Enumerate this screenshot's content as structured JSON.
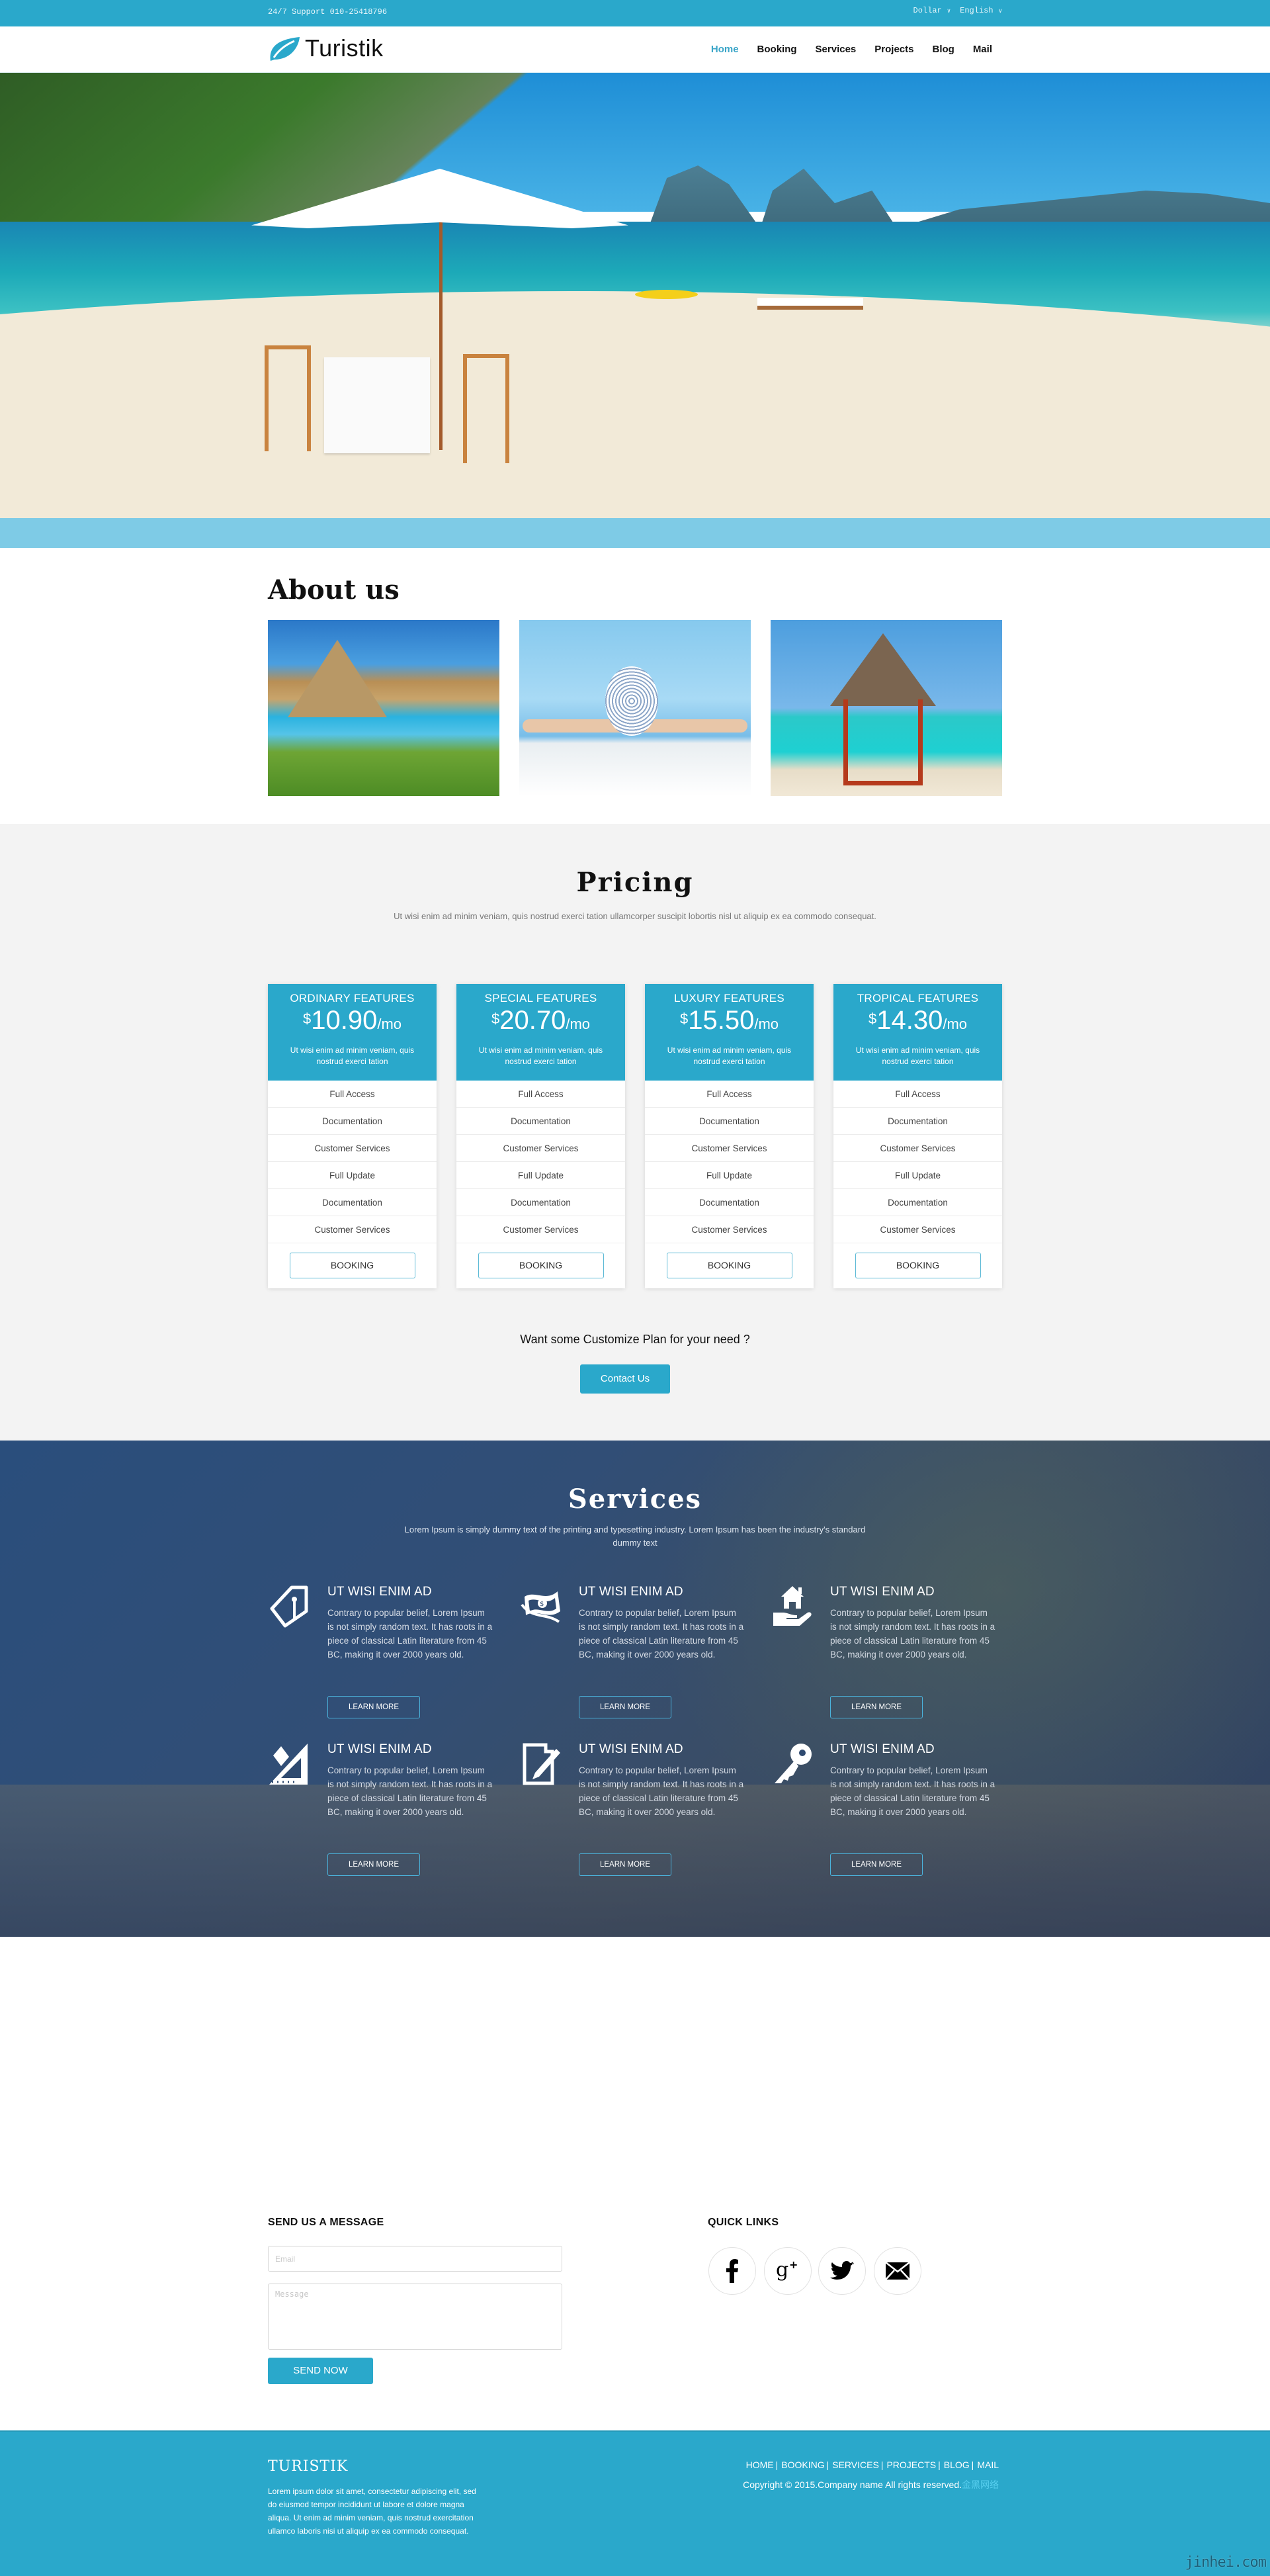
{
  "topbar": {
    "support": "24/7 Support 010-25418796",
    "currency": "Dollar",
    "language": "English"
  },
  "nav": {
    "brand": "Turistik",
    "items": [
      {
        "label": "Home",
        "active": true
      },
      {
        "label": "Booking",
        "active": false
      },
      {
        "label": "Services",
        "active": false
      },
      {
        "label": "Projects",
        "active": false
      },
      {
        "label": "Blog",
        "active": false
      },
      {
        "label": "Mail",
        "active": false
      }
    ]
  },
  "about": {
    "title": "About us",
    "images": [
      "thatched-umbrella-pool",
      "woman-hat-pool",
      "beach-gazebo"
    ]
  },
  "pricing": {
    "title": "Pricing",
    "subtitle": "Ut wisi enim ad minim veniam, quis nostrud exerci tation ullamcorper suscipit lobortis nisl ut aliquip ex ea commodo consequat.",
    "cards": [
      {
        "name": "ORDINARY FEATURES",
        "currency": "$",
        "price": "10.90",
        "period": "/mo",
        "desc": "Ut wisi enim ad minim veniam, quis nostrud exerci tation",
        "features": [
          "Full Access",
          "Documentation",
          "Customer Services",
          "Full Update",
          "Documentation",
          "Customer Services"
        ],
        "button": "BOOKING"
      },
      {
        "name": "SPECIAL FEATURES",
        "currency": "$",
        "price": "20.70",
        "period": "/mo",
        "desc": "Ut wisi enim ad minim veniam, quis nostrud exerci tation",
        "features": [
          "Full Access",
          "Documentation",
          "Customer Services",
          "Full Update",
          "Documentation",
          "Customer Services"
        ],
        "button": "BOOKING"
      },
      {
        "name": "LUXURY FEATURES",
        "currency": "$",
        "price": "15.50",
        "period": "/mo",
        "desc": "Ut wisi enim ad minim veniam, quis nostrud exerci tation",
        "features": [
          "Full Access",
          "Documentation",
          "Customer Services",
          "Full Update",
          "Documentation",
          "Customer Services"
        ],
        "button": "BOOKING"
      },
      {
        "name": "TROPICAL FEATURES",
        "currency": "$",
        "price": "14.30",
        "period": "/mo",
        "desc": "Ut wisi enim ad minim veniam, quis nostrud exerci tation",
        "features": [
          "Full Access",
          "Documentation",
          "Customer Services",
          "Full Update",
          "Documentation",
          "Customer Services"
        ],
        "button": "BOOKING"
      }
    ],
    "custom_question": "Want some Customize Plan for your need ?",
    "contact_button": "Contact Us"
  },
  "services": {
    "title": "Services",
    "subtitle": "Lorem Ipsum is simply dummy text of the printing and typesetting industry. Lorem Ipsum has been the industry's standard dummy text",
    "items": [
      {
        "icon": "price-tag-icon",
        "title": "UT WISI ENIM AD",
        "text": "Contrary to popular belief, Lorem Ipsum is not simply random text. It has roots in a piece of classical Latin literature from 45 BC, making it over 2000 years old.",
        "button": "LEARN MORE"
      },
      {
        "icon": "money-icon",
        "title": "UT WISI ENIM AD",
        "text": "Contrary to popular belief, Lorem Ipsum is not simply random text. It has roots in a piece of classical Latin literature from 45 BC, making it over 2000 years old.",
        "button": "LEARN MORE"
      },
      {
        "icon": "house-in-hand-icon",
        "title": "UT WISI ENIM AD",
        "text": "Contrary to popular belief, Lorem Ipsum is not simply random text. It has roots in a piece of classical Latin literature from 45 BC, making it over 2000 years old.",
        "button": "LEARN MORE"
      },
      {
        "icon": "ruler-triangle-icon",
        "title": "UT WISI ENIM AD",
        "text": "Contrary to popular belief, Lorem Ipsum is not simply random text. It has roots in a piece of classical Latin literature from 45 BC, making it over 2000 years old.",
        "button": "LEARN MORE"
      },
      {
        "icon": "document-pen-icon",
        "title": "UT WISI ENIM AD",
        "text": "Contrary to popular belief, Lorem Ipsum is not simply random text. It has roots in a piece of classical Latin literature from 45 BC, making it over 2000 years old.",
        "button": "LEARN MORE"
      },
      {
        "icon": "key-icon",
        "title": "UT WISI ENIM AD",
        "text": "Contrary to popular belief, Lorem Ipsum is not simply random text. It has roots in a piece of classical Latin literature from 45 BC, making it over 2000 years old.",
        "button": "LEARN MORE"
      }
    ]
  },
  "contact": {
    "heading": "SEND US A MESSAGE",
    "email_placeholder": "Email",
    "message_placeholder": "Message",
    "send_button": "SEND NOW",
    "quick_links_heading": "QUICK LINKS",
    "social": [
      "facebook",
      "google-plus",
      "twitter",
      "mail"
    ]
  },
  "footer": {
    "brand": "TURISTIK",
    "text": "Lorem ipsum dolor sit amet, consectetur adipiscing elit, sed do eiusmod tempor incididunt ut labore et dolore magna aliqua. Ut enim ad minim veniam, quis nostrud exercitation ullamco laboris nisi ut aliquip ex ea commodo consequat.",
    "links": [
      "HOME",
      "BOOKING",
      "SERVICES",
      "PROJECTS",
      "BLOG",
      "MAIL"
    ],
    "copyright": "Copyright © 2015.Company name All rights reserved.",
    "copyright_brand": "金黑网络",
    "watermark": "jinhei.com"
  },
  "colors": {
    "accent": "#2aa8cb",
    "nav_active": "#3aa5c8",
    "pricing_bg": "#f3f3f3",
    "hero_band": "#7ecbe6"
  }
}
